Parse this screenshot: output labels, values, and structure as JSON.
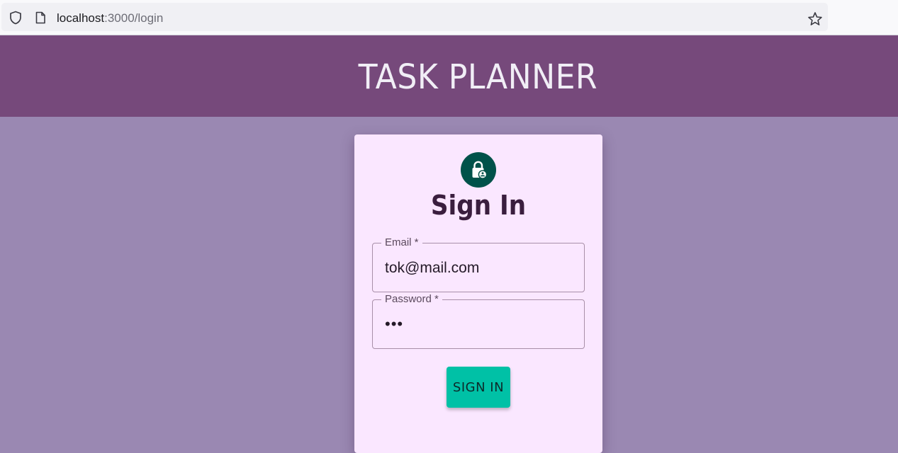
{
  "browser": {
    "url_host": "localhost",
    "url_path": ":3000/login",
    "icons": [
      "shield-icon",
      "page-icon",
      "star-icon"
    ]
  },
  "header": {
    "title": "TASK PLANNER"
  },
  "login_card": {
    "avatar_icon": "lock-person-icon",
    "title": "Sign In",
    "email": {
      "label": "Email *",
      "value": "tok@mail.com"
    },
    "password": {
      "label": "Password *",
      "masked_value": "•••"
    },
    "submit_label": "SIGN IN"
  },
  "colors": {
    "header_bg": "#76497b",
    "page_bg": "#9a88b2",
    "card_bg": "#fae7ff",
    "avatar_bg": "#00524a",
    "button_bg": "#00c1a6"
  }
}
